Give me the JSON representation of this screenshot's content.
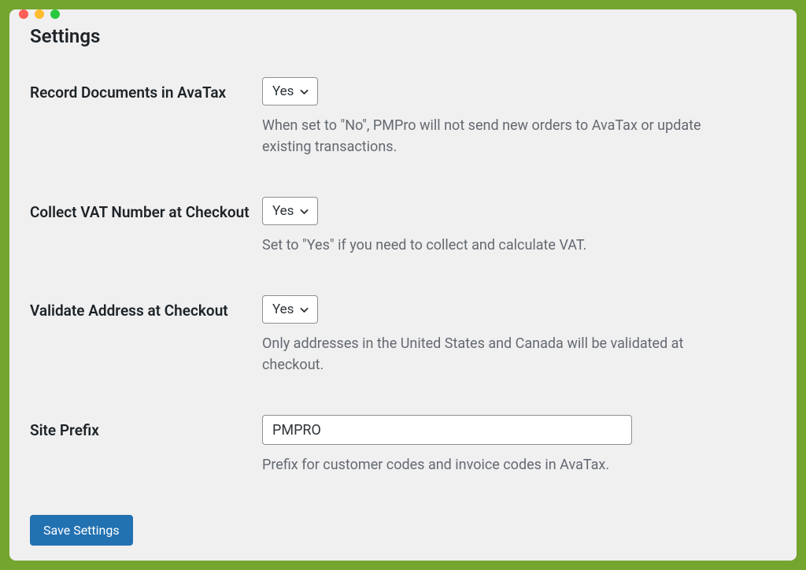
{
  "page": {
    "title": "Settings"
  },
  "fields": {
    "record_documents": {
      "label": "Record Documents in AvaTax",
      "value": "Yes",
      "description": "When set to \"No\", PMPro will not send new orders to AvaTax or update existing transactions."
    },
    "collect_vat": {
      "label": "Collect VAT Number at Checkout",
      "value": "Yes",
      "description": "Set to \"Yes\" if you need to collect and calculate VAT."
    },
    "validate_address": {
      "label": "Validate Address at Checkout",
      "value": "Yes",
      "description": "Only addresses in the United States and Canada will be validated at checkout."
    },
    "site_prefix": {
      "label": "Site Prefix",
      "value": "PMPRO",
      "description": "Prefix for customer codes and invoice codes in AvaTax."
    }
  },
  "actions": {
    "save_label": "Save Settings"
  }
}
